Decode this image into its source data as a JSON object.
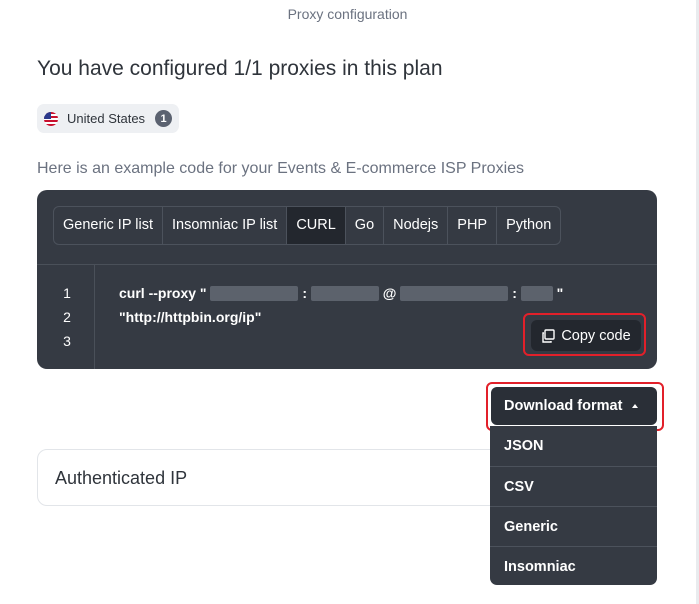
{
  "header": {
    "title": "Proxy configuration"
  },
  "headline": "You have configured 1/1 proxies in this plan",
  "country_chip": {
    "icon": "us-flag-icon",
    "label": "United States",
    "count": "1"
  },
  "example_label": "Here is an example code for your Events & E-commerce ISP Proxies",
  "code_panel": {
    "tabs": [
      {
        "label": "Generic IP list",
        "active": false
      },
      {
        "label": "Insomniac IP list",
        "active": false
      },
      {
        "label": "CURL",
        "active": true
      },
      {
        "label": "Go",
        "active": false
      },
      {
        "label": "Nodejs",
        "active": false
      },
      {
        "label": "PHP",
        "active": false
      },
      {
        "label": "Python",
        "active": false
      }
    ],
    "line_numbers": [
      "1",
      "2",
      "3"
    ],
    "code": {
      "line1_prefix": "curl --proxy \"",
      "sep_colon": ":",
      "sep_at": "@",
      "line1_suffix": "\"",
      "line2": "\"http://httpbin.org/ip\""
    },
    "copy_button": "Copy code"
  },
  "download": {
    "label": "Download format",
    "options": [
      "JSON",
      "CSV",
      "Generic",
      "Insomniac"
    ]
  },
  "authenticated_ip": {
    "title": "Authenticated IP"
  },
  "colors": {
    "code_bg": "#353a43",
    "active_tab_bg": "#23272e",
    "highlight": "#e2202a"
  }
}
